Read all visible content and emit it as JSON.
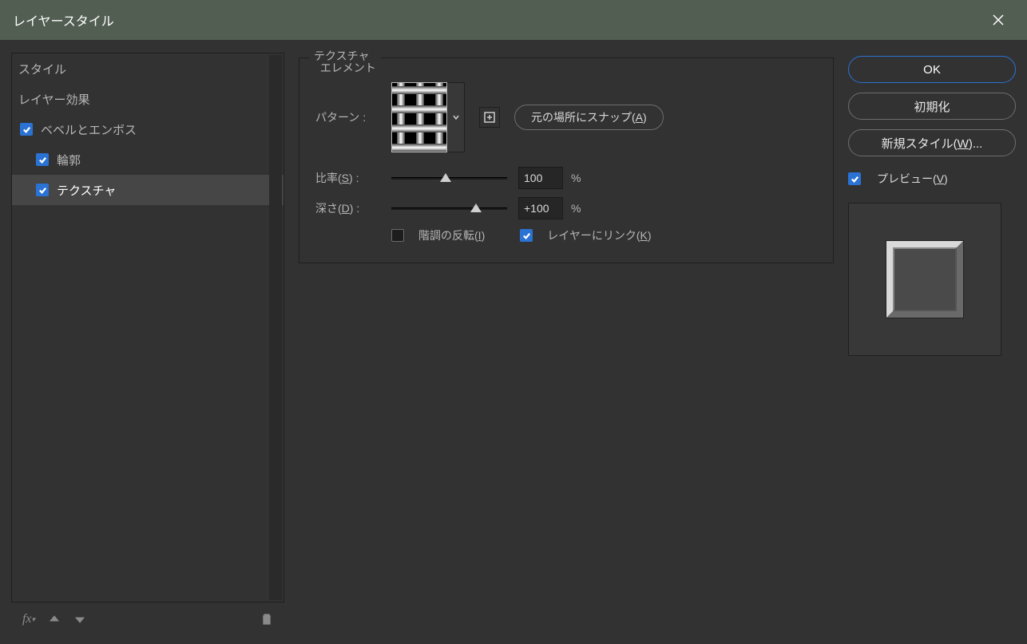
{
  "titlebar": {
    "title": "レイヤースタイル"
  },
  "sidebar": {
    "styles_label": "スタイル",
    "blending_label": "レイヤー効果",
    "items": [
      {
        "label": "ベベルとエンボス",
        "checked": true,
        "selected": false,
        "indent": 1
      },
      {
        "label": "輪郭",
        "checked": true,
        "selected": false,
        "indent": 2
      },
      {
        "label": "テクスチャ",
        "checked": true,
        "selected": true,
        "indent": 2
      }
    ]
  },
  "panel": {
    "group_title_1": "テクスチャ",
    "group_title_2": "エレメント",
    "pattern_label": "パターン :",
    "snap_button": "元の場所にスナップ",
    "snap_key": "A",
    "scale_label": "比率",
    "scale_key": "S",
    "scale_value": "100",
    "scale_unit": "%",
    "scale_pos_pct": 47,
    "depth_label": "深さ",
    "depth_key": "D",
    "depth_value": "+100",
    "depth_unit": "%",
    "depth_pos_pct": 73,
    "invert_label": "階調の反転",
    "invert_key": "I",
    "invert_checked": false,
    "link_label": "レイヤーにリンク",
    "link_key": "K",
    "link_checked": true
  },
  "right": {
    "ok": "OK",
    "reset": "初期化",
    "new_style": "新規スタイル",
    "new_style_key": "W",
    "preview_label": "プレビュー",
    "preview_key": "V",
    "preview_checked": true
  }
}
